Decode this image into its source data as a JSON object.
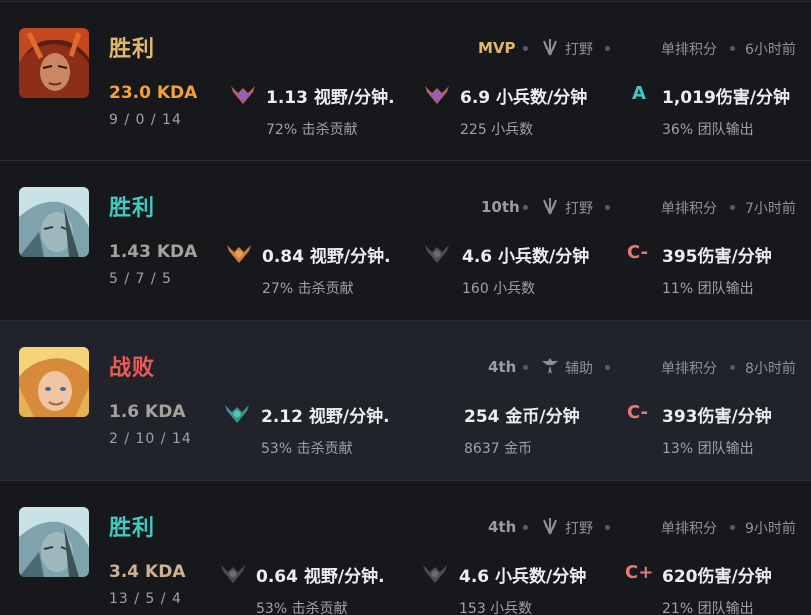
{
  "matches": [
    {
      "result": "胜利",
      "kda": "23.0 KDA",
      "kda_detail": "9 / 0 / 14",
      "rank": "MVP",
      "role": "打野",
      "role_icon": "jungle-icon",
      "queue": "单排积分",
      "time": "6小时前",
      "stat1": {
        "value": "1.13 视野/分钟.",
        "sub": "72% 击杀贡献"
      },
      "stat2": {
        "value": "6.9 小兵数/分钟",
        "sub": "225 小兵数"
      },
      "grade": "A",
      "damage": {
        "value": "1,019伤害/分钟",
        "sub": "36% 团队输出"
      }
    },
    {
      "result": "胜利",
      "kda": "1.43 KDA",
      "kda_detail": "5 / 7 / 5",
      "rank": "10th",
      "role": "打野",
      "role_icon": "jungle-icon",
      "queue": "单排积分",
      "time": "7小时前",
      "stat1": {
        "value": "0.84 视野/分钟.",
        "sub": "27% 击杀贡献"
      },
      "stat2": {
        "value": "4.6 小兵数/分钟",
        "sub": "160 小兵数"
      },
      "grade": "C-",
      "damage": {
        "value": "395伤害/分钟",
        "sub": "11% 团队输出"
      }
    },
    {
      "result": "战败",
      "kda": "1.6 KDA",
      "kda_detail": "2 / 10 / 14",
      "rank": "4th",
      "role": "辅助",
      "role_icon": "support-icon",
      "queue": "单排积分",
      "time": "8小时前",
      "stat1": {
        "value": "2.12 视野/分钟.",
        "sub": "53% 击杀贡献"
      },
      "stat2": {
        "value": "254 金币/分钟",
        "sub": "8637 金币"
      },
      "grade": "C-",
      "damage": {
        "value": "393伤害/分钟",
        "sub": "13% 团队输出"
      }
    },
    {
      "result": "胜利",
      "kda": "3.4 KDA",
      "kda_detail": "13 / 5 / 4",
      "rank": "4th",
      "role": "打野",
      "role_icon": "jungle-icon",
      "queue": "单排积分",
      "time": "9小时前",
      "stat1": {
        "value": "0.64 视野/分钟.",
        "sub": "53% 击杀贡献"
      },
      "stat2": {
        "value": "4.6 小兵数/分钟",
        "sub": "153 小兵数"
      },
      "grade": "C+",
      "damage": {
        "value": "620伤害/分钟",
        "sub": "21% 团队输出"
      }
    }
  ],
  "colors": {
    "win": "#3ec9c1",
    "win_gold": "#e3b768",
    "loss": "#ea5a56",
    "kda_orange": "#f3a13a",
    "grade_a": "#3ec9c1",
    "grade_c": "#e07a77"
  }
}
